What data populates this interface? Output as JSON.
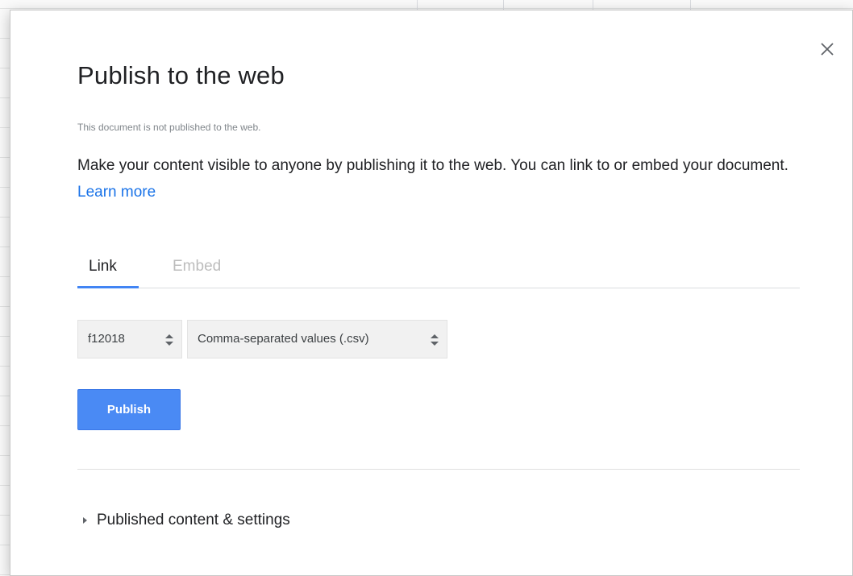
{
  "dialog": {
    "title": "Publish to the web",
    "status": "This document is not published to the web.",
    "description": "Make your content visible to anyone by publishing it to the web. You can link to or embed your document.",
    "learn_more": "Learn more",
    "close_icon": "close-icon"
  },
  "tabs": [
    {
      "label": "Link",
      "selected": true
    },
    {
      "label": "Embed",
      "selected": false
    }
  ],
  "selects": {
    "sheet": "f12018",
    "format": "Comma-separated values (.csv)"
  },
  "publish_label": "Publish",
  "disclosure_label": "Published content & settings",
  "colors": {
    "accent": "#4285f4",
    "button": "#4a8af4",
    "link": "#1a73e8"
  }
}
